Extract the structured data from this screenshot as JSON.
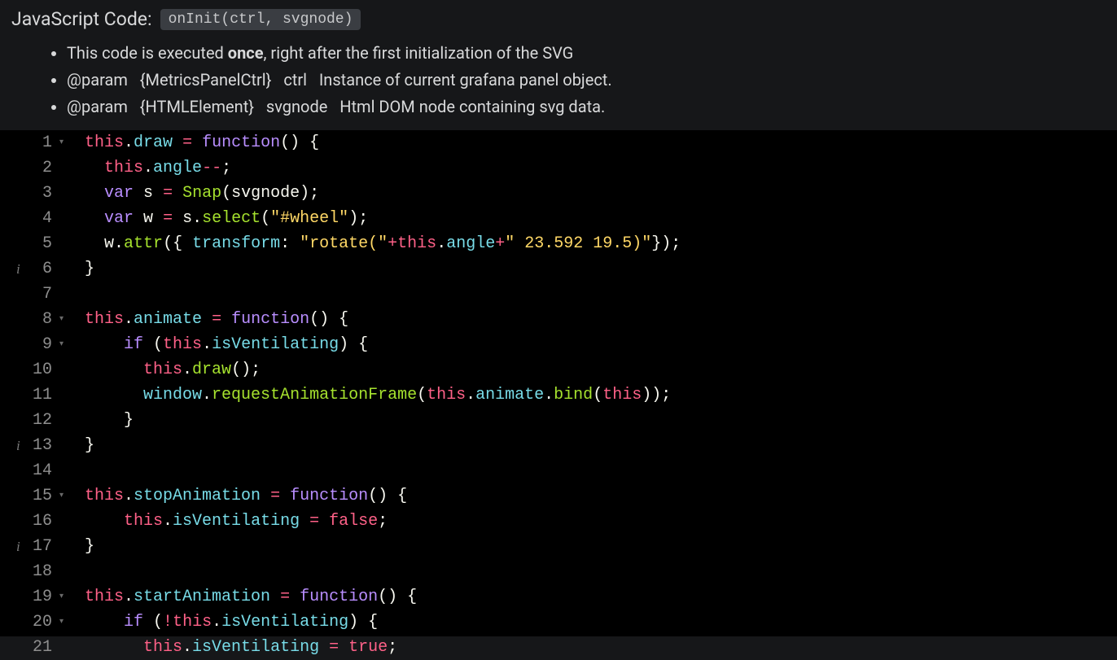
{
  "header": {
    "title": "JavaScript Code:",
    "signature": "onInit(ctrl, svgnode)",
    "bullets": [
      {
        "prefix": "This code is executed ",
        "bold": "once",
        "suffix": ", right after the first initialization of the SVG"
      },
      {
        "text": "@param   {MetricsPanelCtrl}   ctrl   Instance of current grafana panel object."
      },
      {
        "text": "@param   {HTMLElement}   svgnode   Html DOM node containing svg data."
      }
    ]
  },
  "editor": {
    "gutter": [
      {
        "n": 1,
        "fold": true
      },
      {
        "n": 2
      },
      {
        "n": 3
      },
      {
        "n": 4
      },
      {
        "n": 5
      },
      {
        "n": 6,
        "info": true
      },
      {
        "n": 7
      },
      {
        "n": 8,
        "fold": true
      },
      {
        "n": 9,
        "fold": true
      },
      {
        "n": 10
      },
      {
        "n": 11
      },
      {
        "n": 12
      },
      {
        "n": 13,
        "info": true
      },
      {
        "n": 14
      },
      {
        "n": 15,
        "fold": true
      },
      {
        "n": 16
      },
      {
        "n": 17,
        "info": true
      },
      {
        "n": 18
      },
      {
        "n": 19,
        "fold": true
      },
      {
        "n": 20,
        "fold": true
      },
      {
        "n": 21
      }
    ],
    "lines": [
      [
        {
          "c": "this",
          "t": "this"
        },
        {
          "c": "pun",
          "t": "."
        },
        {
          "c": "prop",
          "t": "draw"
        },
        {
          "c": "pun",
          "t": " "
        },
        {
          "c": "op",
          "t": "="
        },
        {
          "c": "pun",
          "t": " "
        },
        {
          "c": "kw",
          "t": "function"
        },
        {
          "c": "pun",
          "t": "() {"
        }
      ],
      [
        {
          "c": "pun",
          "t": "  "
        },
        {
          "c": "this",
          "t": "this"
        },
        {
          "c": "pun",
          "t": "."
        },
        {
          "c": "prop",
          "t": "angle"
        },
        {
          "c": "op",
          "t": "--"
        },
        {
          "c": "pun",
          "t": ";"
        }
      ],
      [
        {
          "c": "pun",
          "t": "  "
        },
        {
          "c": "kw",
          "t": "var"
        },
        {
          "c": "pun",
          "t": " "
        },
        {
          "c": "ident",
          "t": "s"
        },
        {
          "c": "pun",
          "t": " "
        },
        {
          "c": "op",
          "t": "="
        },
        {
          "c": "pun",
          "t": " "
        },
        {
          "c": "fn",
          "t": "Snap"
        },
        {
          "c": "pun",
          "t": "("
        },
        {
          "c": "ident",
          "t": "svgnode"
        },
        {
          "c": "pun",
          "t": ");"
        }
      ],
      [
        {
          "c": "pun",
          "t": "  "
        },
        {
          "c": "kw",
          "t": "var"
        },
        {
          "c": "pun",
          "t": " "
        },
        {
          "c": "ident",
          "t": "w"
        },
        {
          "c": "pun",
          "t": " "
        },
        {
          "c": "op",
          "t": "="
        },
        {
          "c": "pun",
          "t": " "
        },
        {
          "c": "ident",
          "t": "s"
        },
        {
          "c": "pun",
          "t": "."
        },
        {
          "c": "fn",
          "t": "select"
        },
        {
          "c": "pun",
          "t": "("
        },
        {
          "c": "str",
          "t": "\"#wheel\""
        },
        {
          "c": "pun",
          "t": ");"
        }
      ],
      [
        {
          "c": "pun",
          "t": "  "
        },
        {
          "c": "ident",
          "t": "w"
        },
        {
          "c": "pun",
          "t": "."
        },
        {
          "c": "fn",
          "t": "attr"
        },
        {
          "c": "pun",
          "t": "({ "
        },
        {
          "c": "key",
          "t": "transform"
        },
        {
          "c": "pun",
          "t": ": "
        },
        {
          "c": "str",
          "t": "\"rotate(\""
        },
        {
          "c": "op",
          "t": "+"
        },
        {
          "c": "this",
          "t": "this"
        },
        {
          "c": "pun",
          "t": "."
        },
        {
          "c": "prop",
          "t": "angle"
        },
        {
          "c": "op",
          "t": "+"
        },
        {
          "c": "str",
          "t": "\" 23.592 19.5)\""
        },
        {
          "c": "pun",
          "t": "});"
        }
      ],
      [
        {
          "c": "pun",
          "t": "}"
        }
      ],
      [],
      [
        {
          "c": "this",
          "t": "this"
        },
        {
          "c": "pun",
          "t": "."
        },
        {
          "c": "prop",
          "t": "animate"
        },
        {
          "c": "pun",
          "t": " "
        },
        {
          "c": "op",
          "t": "="
        },
        {
          "c": "pun",
          "t": " "
        },
        {
          "c": "kw",
          "t": "function"
        },
        {
          "c": "pun",
          "t": "() {"
        }
      ],
      [
        {
          "c": "pun",
          "t": "    "
        },
        {
          "c": "kw",
          "t": "if"
        },
        {
          "c": "pun",
          "t": " ("
        },
        {
          "c": "this",
          "t": "this"
        },
        {
          "c": "pun",
          "t": "."
        },
        {
          "c": "prop",
          "t": "isVentilating"
        },
        {
          "c": "pun",
          "t": ") {"
        }
      ],
      [
        {
          "c": "pun",
          "t": "      "
        },
        {
          "c": "this",
          "t": "this"
        },
        {
          "c": "pun",
          "t": "."
        },
        {
          "c": "fn",
          "t": "draw"
        },
        {
          "c": "pun",
          "t": "();"
        }
      ],
      [
        {
          "c": "pun",
          "t": "      "
        },
        {
          "c": "win",
          "t": "window"
        },
        {
          "c": "pun",
          "t": "."
        },
        {
          "c": "fn",
          "t": "requestAnimationFrame"
        },
        {
          "c": "pun",
          "t": "("
        },
        {
          "c": "this",
          "t": "this"
        },
        {
          "c": "pun",
          "t": "."
        },
        {
          "c": "prop",
          "t": "animate"
        },
        {
          "c": "pun",
          "t": "."
        },
        {
          "c": "fn",
          "t": "bind"
        },
        {
          "c": "pun",
          "t": "("
        },
        {
          "c": "this",
          "t": "this"
        },
        {
          "c": "pun",
          "t": "));"
        }
      ],
      [
        {
          "c": "pun",
          "t": "    }"
        }
      ],
      [
        {
          "c": "pun",
          "t": "}"
        }
      ],
      [],
      [
        {
          "c": "this",
          "t": "this"
        },
        {
          "c": "pun",
          "t": "."
        },
        {
          "c": "prop",
          "t": "stopAnimation"
        },
        {
          "c": "pun",
          "t": " "
        },
        {
          "c": "op",
          "t": "="
        },
        {
          "c": "pun",
          "t": " "
        },
        {
          "c": "kw",
          "t": "function"
        },
        {
          "c": "pun",
          "t": "() {"
        }
      ],
      [
        {
          "c": "pun",
          "t": "    "
        },
        {
          "c": "this",
          "t": "this"
        },
        {
          "c": "pun",
          "t": "."
        },
        {
          "c": "prop",
          "t": "isVentilating"
        },
        {
          "c": "pun",
          "t": " "
        },
        {
          "c": "op",
          "t": "="
        },
        {
          "c": "pun",
          "t": " "
        },
        {
          "c": "this",
          "t": "false"
        },
        {
          "c": "pun",
          "t": ";"
        }
      ],
      [
        {
          "c": "pun",
          "t": "}"
        }
      ],
      [],
      [
        {
          "c": "this",
          "t": "this"
        },
        {
          "c": "pun",
          "t": "."
        },
        {
          "c": "prop",
          "t": "startAnimation"
        },
        {
          "c": "pun",
          "t": " "
        },
        {
          "c": "op",
          "t": "="
        },
        {
          "c": "pun",
          "t": " "
        },
        {
          "c": "kw",
          "t": "function"
        },
        {
          "c": "pun",
          "t": "() {"
        }
      ],
      [
        {
          "c": "pun",
          "t": "    "
        },
        {
          "c": "kw",
          "t": "if"
        },
        {
          "c": "pun",
          "t": " ("
        },
        {
          "c": "op",
          "t": "!"
        },
        {
          "c": "this",
          "t": "this"
        },
        {
          "c": "pun",
          "t": "."
        },
        {
          "c": "prop",
          "t": "isVentilating"
        },
        {
          "c": "pun",
          "t": ") {"
        }
      ],
      [
        {
          "c": "pun",
          "t": "      "
        },
        {
          "c": "this",
          "t": "this"
        },
        {
          "c": "pun",
          "t": "."
        },
        {
          "c": "prop",
          "t": "isVentilating"
        },
        {
          "c": "pun",
          "t": " "
        },
        {
          "c": "op",
          "t": "="
        },
        {
          "c": "pun",
          "t": " "
        },
        {
          "c": "this",
          "t": "true"
        },
        {
          "c": "pun",
          "t": ";"
        }
      ]
    ]
  }
}
